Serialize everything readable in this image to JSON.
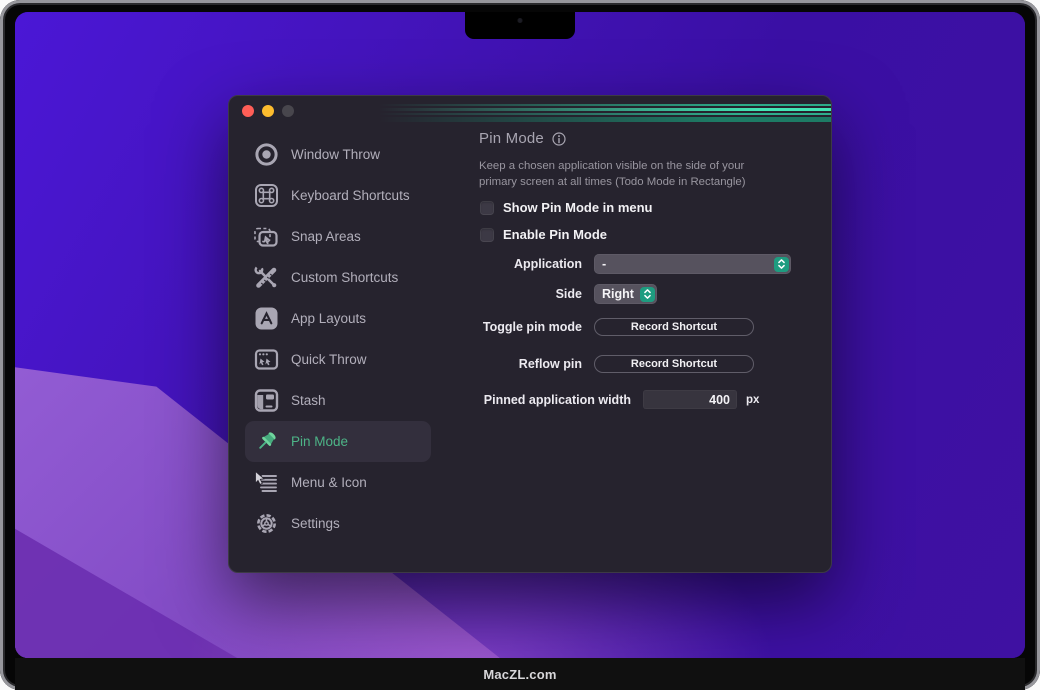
{
  "device": {
    "brand_text": "MacZL.com"
  },
  "window": {
    "traffic_lights": [
      {
        "name": "close",
        "color": "#ff5e57"
      },
      {
        "name": "minimize",
        "color": "#fdbc2e"
      },
      {
        "name": "zoom-disabled",
        "color": "#48464d"
      }
    ],
    "sidebar": {
      "items": [
        {
          "label": "Window Throw",
          "icon": "target-icon",
          "selected": false
        },
        {
          "label": "Keyboard Shortcuts",
          "icon": "command-key-icon",
          "selected": false
        },
        {
          "label": "Snap Areas",
          "icon": "snap-cursor-icon",
          "selected": false
        },
        {
          "label": "Custom Shortcuts",
          "icon": "tools-icon",
          "selected": false
        },
        {
          "label": "App Layouts",
          "icon": "appstore-icon",
          "selected": false
        },
        {
          "label": "Quick Throw",
          "icon": "cursors-window-icon",
          "selected": false
        },
        {
          "label": "Stash",
          "icon": "drawer-icon",
          "selected": false
        },
        {
          "label": "Pin Mode",
          "icon": "pushpin-icon",
          "selected": true
        },
        {
          "label": "Menu & Icon",
          "icon": "menu-lines-cursor-icon",
          "selected": false
        },
        {
          "label": "Settings",
          "icon": "gear-icon",
          "selected": false
        }
      ]
    },
    "content": {
      "title": "Pin Mode",
      "title_icon": "info-icon",
      "description": "Keep a chosen application visible on the side of your primary screen at all times (Todo Mode in Rectangle)",
      "checkboxes": [
        {
          "label": "Show Pin Mode in menu",
          "checked": false
        },
        {
          "label": "Enable Pin Mode",
          "checked": false
        }
      ],
      "fields": {
        "application": {
          "label": "Application",
          "value": "-"
        },
        "side": {
          "label": "Side",
          "value": "Right"
        },
        "toggle": {
          "label": "Toggle pin mode",
          "button": "Record Shortcut"
        },
        "reflow": {
          "label": "Reflow pin",
          "button": "Record Shortcut"
        },
        "width": {
          "label": "Pinned application width",
          "value": "400",
          "unit": "px"
        }
      }
    },
    "colors": {
      "accent_green": "#4db487",
      "teal_stepper": "#1e9c80",
      "stripe_teal": "#43e6b4",
      "window_bg": "#26232e"
    }
  }
}
